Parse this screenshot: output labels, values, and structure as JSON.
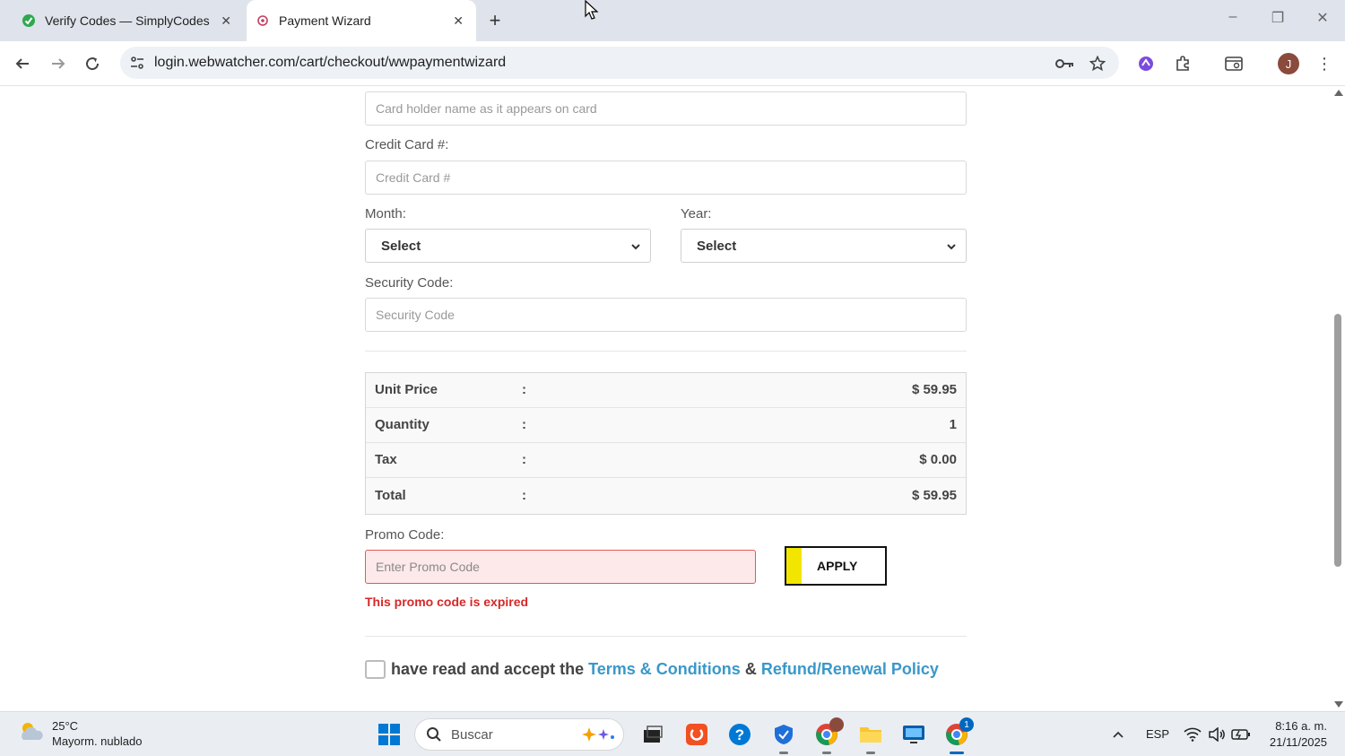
{
  "browser": {
    "tabs": [
      {
        "title": "Verify Codes — SimplyCodes",
        "active": false
      },
      {
        "title": "Payment Wizard",
        "active": true
      }
    ],
    "url": "login.webwatcher.com/cart/checkout/wwpaymentwizard",
    "profile_initial": "J"
  },
  "form": {
    "cardholder_placeholder": "Card holder name as it appears on card",
    "cc_label": "Credit Card #:",
    "cc_placeholder": "Credit Card #",
    "month_label": "Month:",
    "month_value": "Select",
    "year_label": "Year:",
    "year_value": "Select",
    "security_label": "Security Code:",
    "security_placeholder": "Security Code"
  },
  "summary": {
    "rows": [
      {
        "label": "Unit Price",
        "sep": ":",
        "value": "$ 59.95"
      },
      {
        "label": "Quantity",
        "sep": ":",
        "value": "1"
      },
      {
        "label": "Tax",
        "sep": ":",
        "value": "$ 0.00"
      },
      {
        "label": "Total",
        "sep": ":",
        "value": "$ 59.95"
      }
    ]
  },
  "promo": {
    "label": "Promo Code:",
    "placeholder": "Enter Promo Code",
    "apply_label": "APPLY",
    "error": "This promo code is expired"
  },
  "terms": {
    "prefix": "have read and accept the",
    "link1": "Terms & Conditions",
    "amp": "&",
    "link2": "Refund/Renewal Policy"
  },
  "taskbar": {
    "weather_temp": "25°C",
    "weather_desc": "Mayorm. nublado",
    "search_placeholder": "Buscar",
    "language": "ESP",
    "time": "8:16 a. m.",
    "date": "21/11/2025",
    "chrome_badge": "1"
  },
  "colors": {
    "link": "#3a98c9",
    "error": "#d62828",
    "apply_accent": "#f2e600"
  }
}
